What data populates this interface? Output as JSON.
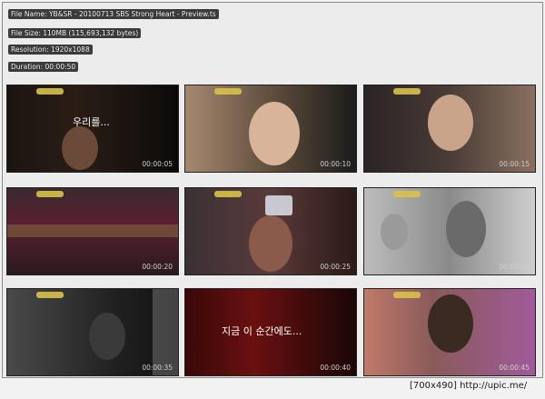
{
  "header": {
    "file_name": "File Name: YB&SR - 20100713 SBS Strong Heart - Preview.ts",
    "file_size": "File Size: 110MB (115,693,132 bytes)",
    "resolution": "Resolution: 1920x1088",
    "duration": "Duration: 00:00:50"
  },
  "thumbnails": [
    {
      "timestamp": "00:00:05",
      "caption": "우리를..."
    },
    {
      "timestamp": "00:00:10"
    },
    {
      "timestamp": "00:00:15"
    },
    {
      "timestamp": "00:00:20"
    },
    {
      "timestamp": "00:00:25"
    },
    {
      "timestamp": "00:00:30"
    },
    {
      "timestamp": "00:00:35"
    },
    {
      "timestamp": "00:00:40",
      "caption": "지금 이 순간에도..."
    },
    {
      "timestamp": "00:00:45"
    }
  ],
  "footer": {
    "text": "[700x490] http://upic.me/"
  }
}
